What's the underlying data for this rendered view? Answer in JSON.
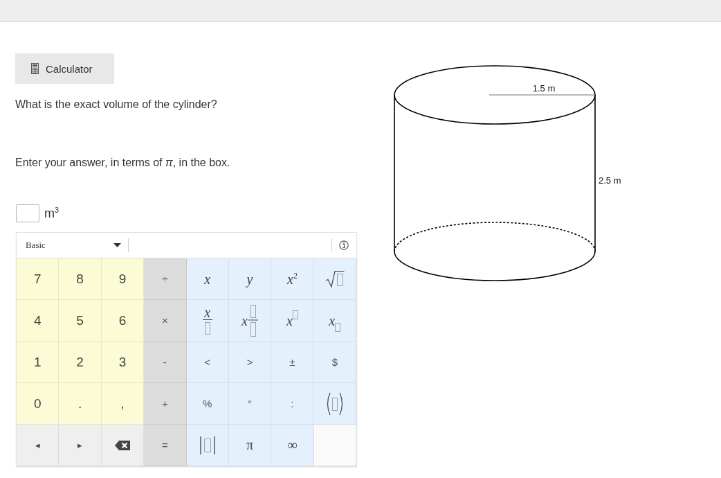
{
  "calculator_button": {
    "label": "Calculator"
  },
  "question": {
    "prompt": "What is the exact volume of the cylinder?",
    "instruction": "Enter your answer, in terms of *π*, in the box.",
    "unit": "m$^{3}$"
  },
  "keypad": {
    "mode": "Basic",
    "rows": [
      [
        {
          "kind": "digit",
          "color": "#fbfbd5",
          "label": "7"
        },
        {
          "kind": "digit",
          "color": "#fbfbd5",
          "label": "8"
        },
        {
          "kind": "digit",
          "color": "#fbfbd5",
          "label": "9"
        },
        {
          "kind": "text",
          "color": "#dcdcdc",
          "label": "÷"
        },
        {
          "kind": "math",
          "color": "#e4f1fc",
          "label": "x"
        },
        {
          "kind": "math",
          "color": "#e4f1fc",
          "label": "y"
        },
        {
          "kind": "math",
          "color": "#e4f1fc",
          "label": "x$^{2}$"
        },
        {
          "kind": "sqrt",
          "color": "#e4f1fc"
        }
      ],
      [
        {
          "kind": "digit",
          "color": "#fbfbd5",
          "label": "4"
        },
        {
          "kind": "digit",
          "color": "#fbfbd5",
          "label": "5"
        },
        {
          "kind": "digit",
          "color": "#fbfbd5",
          "label": "6"
        },
        {
          "kind": "text",
          "color": "#dcdcdc",
          "label": "×"
        },
        {
          "kind": "fraction",
          "color": "#e4f1fc",
          "label": "x"
        },
        {
          "kind": "mixed",
          "color": "#e4f1fc",
          "label": "x"
        },
        {
          "kind": "power",
          "color": "#e4f1fc",
          "label": "x"
        },
        {
          "kind": "subscript",
          "color": "#e4f1fc",
          "label": "x"
        }
      ],
      [
        {
          "kind": "digit",
          "color": "#fbfbd5",
          "label": "1"
        },
        {
          "kind": "digit",
          "color": "#fbfbd5",
          "label": "2"
        },
        {
          "kind": "digit",
          "color": "#fbfbd5",
          "label": "3"
        },
        {
          "kind": "text",
          "color": "#dcdcdc",
          "label": "-"
        },
        {
          "kind": "text",
          "color": "#e4f1fc",
          "label": "<"
        },
        {
          "kind": "text",
          "color": "#e4f1fc",
          "label": ">"
        },
        {
          "kind": "text",
          "color": "#e4f1fc",
          "label": "±"
        },
        {
          "kind": "text",
          "color": "#e4f1fc",
          "label": "$"
        }
      ],
      [
        {
          "kind": "digit",
          "color": "#fbfbd5",
          "label": "0"
        },
        {
          "kind": "digit",
          "color": "#fbfbd5",
          "label": "."
        },
        {
          "kind": "digit",
          "color": "#fbfbd5",
          "label": ","
        },
        {
          "kind": "text",
          "color": "#dcdcdc",
          "label": "+"
        },
        {
          "kind": "text",
          "color": "#e4f1fc",
          "label": "%"
        },
        {
          "kind": "text",
          "color": "#e4f1fc",
          "label": "°"
        },
        {
          "kind": "text",
          "color": "#e4f1fc",
          "label": ":"
        },
        {
          "kind": "parens",
          "color": "#e4f1fc"
        }
      ],
      [
        {
          "kind": "arrow",
          "color": "#efefef",
          "label": "◂"
        },
        {
          "kind": "arrow",
          "color": "#efefef",
          "label": "▸"
        },
        {
          "kind": "backspace",
          "color": "#efefef"
        },
        {
          "kind": "text",
          "color": "#dcdcdc",
          "label": "="
        },
        {
          "kind": "abs",
          "color": "#e4f1fc"
        },
        {
          "kind": "symbol",
          "color": "#e4f1fc",
          "label": "π"
        },
        {
          "kind": "symbol",
          "color": "#e4f1fc",
          "label": "∞"
        },
        {
          "kind": "blank",
          "color": "#fafafa"
        }
      ]
    ]
  },
  "figure": {
    "radius_label": "1.5 m",
    "height_label": "2.5 m"
  }
}
